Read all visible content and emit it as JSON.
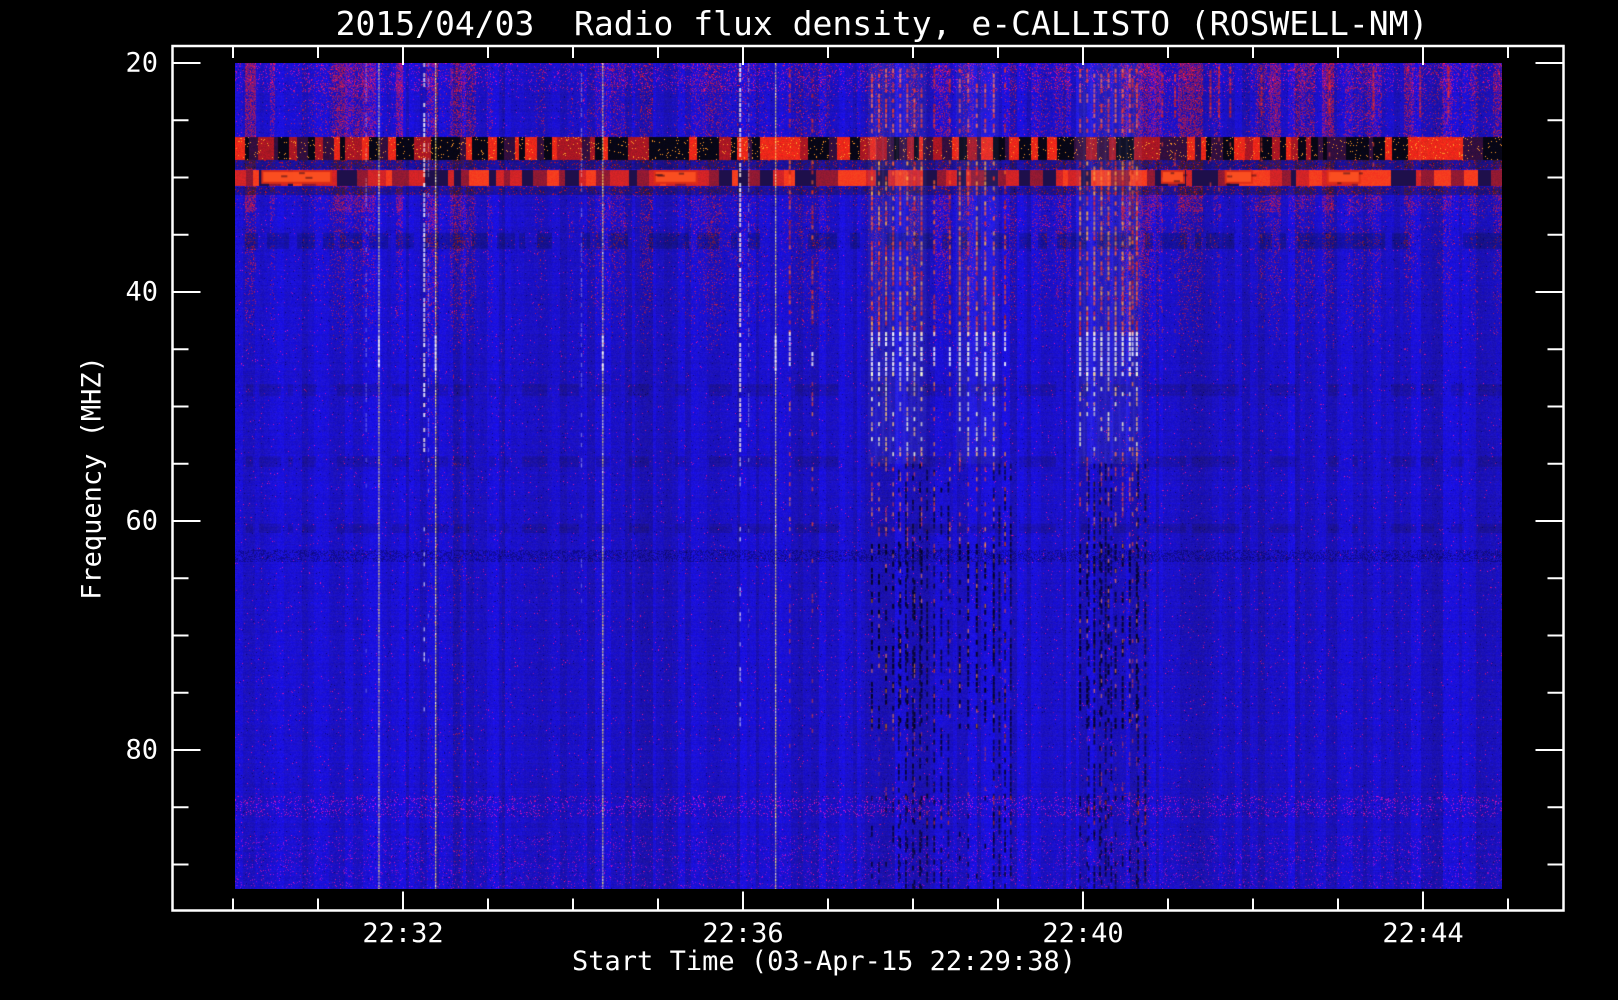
{
  "page": {
    "background": "#000000",
    "text_color": "#ffffff"
  },
  "chart_data": {
    "type": "heatmap",
    "title": "2015/04/03  Radio flux density, e-CALLISTO (ROSWELL-NM)",
    "xlabel": "Start Time (03-Apr-15 22:29:38)",
    "ylabel": "Frequency (MHZ)",
    "date": "2015/04/03",
    "instrument": "e-CALLISTO",
    "station": "ROSWELL-NM",
    "start_time": "22:29:38",
    "x_axis": {
      "major_tick_labels": [
        "22:32",
        "22:36",
        "22:40",
        "22:44"
      ],
      "minor_tick_interval_seconds": 60,
      "first_minor_tick": "22:30:00",
      "last_minor_tick": "22:45:00"
    },
    "y_axis": {
      "major_ticks": [
        20,
        40,
        60,
        80
      ],
      "minor_tick_step": 5,
      "data_range_mhz": [
        20,
        92
      ],
      "direction": "increasing-downward"
    },
    "colormap": {
      "background_blue": "#2424c8",
      "mottle_red": "#8c2030",
      "burst_red": "#e03222",
      "burst_orange": "#ff9a33",
      "line_white": "#ffffff",
      "line_yellow": "#ffec66",
      "band_black": "#060612"
    },
    "bands": [
      {
        "f_mhz": [
          20,
          45
        ],
        "style": "red-mottle",
        "note": "patchy reddish interference, strongest before 22:32 and after 22:40"
      },
      {
        "f_mhz": [
          20,
          22.5
        ],
        "style": "red-speckle-rows"
      },
      {
        "f_mhz": [
          26.4,
          28.4
        ],
        "style": "black-band-with-red-bursts"
      },
      {
        "f_mhz": [
          28.4,
          29.2
        ],
        "style": "dark-row"
      },
      {
        "f_mhz": [
          29.3,
          30.7
        ],
        "style": "red-band"
      },
      {
        "f_mhz": [
          30.8,
          31.5
        ],
        "style": "dark-row"
      },
      {
        "f_mhz": [
          34.8,
          36.2
        ],
        "style": "faint-dark-row"
      },
      {
        "f_mhz": [
          48,
          49
        ],
        "style": "faint-dark-row-light"
      },
      {
        "f_mhz": [
          54.3,
          55.2
        ],
        "style": "faint-dark-row-light"
      },
      {
        "f_mhz": [
          60.2,
          61.0
        ],
        "style": "faint-dark-row-light"
      },
      {
        "f_mhz": [
          62.5,
          63.5
        ],
        "style": "dark-speckle-row"
      },
      {
        "f_mhz": [
          84.0,
          85.8
        ],
        "style": "red-speckle-row"
      },
      {
        "f_mhz": [
          87.5,
          92.0
        ],
        "style": "red-speckle-row-faint"
      }
    ],
    "red_blobs": [
      [
        "22:30:20",
        "22:31:10"
      ],
      [
        "22:34:57",
        "22:35:28"
      ],
      [
        "22:40:55",
        "22:41:12"
      ],
      [
        "22:41:40",
        "22:42:00"
      ],
      [
        "22:42:52",
        "22:43:16"
      ]
    ],
    "streaks": [
      {
        "t": "22:31:34",
        "kind": "faint"
      },
      {
        "t": "22:31:43",
        "kind": "yellow"
      },
      {
        "t": "22:32:15",
        "kind": "white"
      },
      {
        "t": "22:32:18",
        "kind": "faint"
      },
      {
        "t": "22:32:23",
        "kind": "yellow"
      },
      {
        "t": "22:34:06",
        "kind": "faint"
      },
      {
        "t": "22:34:21",
        "kind": "yellow"
      },
      {
        "t": "22:35:58",
        "kind": "white"
      },
      {
        "t": "22:36:04",
        "kind": "faint"
      },
      {
        "t": "22:36:23",
        "kind": "yellow"
      },
      {
        "t": "22:36:33",
        "kind": "red"
      },
      {
        "t": "22:36:49",
        "kind": "red"
      },
      {
        "t": "22:37:31",
        "kind": "cluster",
        "count": 8,
        "spacing_s": 5
      },
      {
        "t": "22:37:50",
        "kind": "dark-cluster",
        "count": 8,
        "spacing_s": 5
      },
      {
        "t": "22:38:15",
        "kind": "red"
      },
      {
        "t": "22:38:26",
        "kind": "red"
      },
      {
        "t": "22:38:33",
        "kind": "cluster",
        "count": 5,
        "spacing_s": 6
      },
      {
        "t": "22:38:57",
        "kind": "dark-cluster",
        "count": 4,
        "spacing_s": 4
      },
      {
        "t": "22:39:05",
        "kind": "red"
      },
      {
        "t": "22:39:58",
        "kind": "cluster",
        "count": 9,
        "spacing_s": 5
      },
      {
        "t": "22:40:04",
        "kind": "dark-cluster",
        "count": 5,
        "spacing_s": 4
      },
      {
        "t": "22:40:35",
        "kind": "red"
      },
      {
        "t": "22:40:39",
        "kind": "dark-cluster",
        "count": 2,
        "spacing_s": 5
      },
      {
        "t": "22:40:56",
        "kind": "red-top"
      },
      {
        "t": "22:41:05",
        "kind": "red-top"
      },
      {
        "t": "22:41:30",
        "kind": "red-top"
      },
      {
        "t": "22:41:36",
        "kind": "red-top"
      },
      {
        "t": "22:41:44",
        "kind": "red-top"
      },
      {
        "t": "22:42:06",
        "kind": "red-top"
      },
      {
        "t": "22:42:54",
        "kind": "red-top"
      },
      {
        "t": "22:43:25",
        "kind": "red-top"
      },
      {
        "t": "22:43:58",
        "kind": "red-top"
      },
      {
        "t": "22:44:18",
        "kind": "red-top"
      }
    ]
  }
}
